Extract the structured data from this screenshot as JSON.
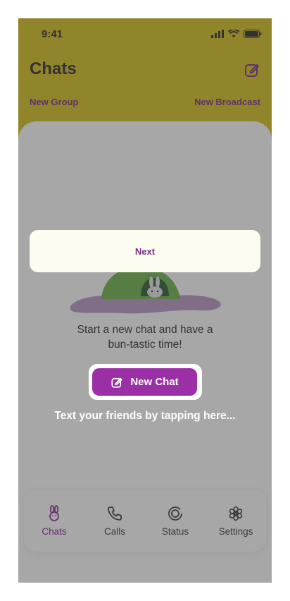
{
  "status_bar": {
    "time": "9:41"
  },
  "header": {
    "title": "Chats"
  },
  "links": {
    "new_group": "New Group",
    "new_broadcast": "New Broadcast"
  },
  "empty_state": {
    "message_line1": "Start a new chat and have a",
    "message_line2": "bun-tastic time!"
  },
  "new_chat_button": {
    "label": "New Chat"
  },
  "tour": {
    "next_label": "Next",
    "hint": "Text your friends by tapping here..."
  },
  "nav": {
    "items": [
      {
        "label": "Chats",
        "icon": "bunny-icon",
        "active": true
      },
      {
        "label": "Calls",
        "icon": "phone-icon",
        "active": false
      },
      {
        "label": "Status",
        "icon": "status-icon",
        "active": false
      },
      {
        "label": "Settings",
        "icon": "gear-icon",
        "active": false
      }
    ]
  },
  "colors": {
    "accent": "#9b2fa6",
    "header_bg": "#d8c21f",
    "link": "#7b2d86"
  }
}
